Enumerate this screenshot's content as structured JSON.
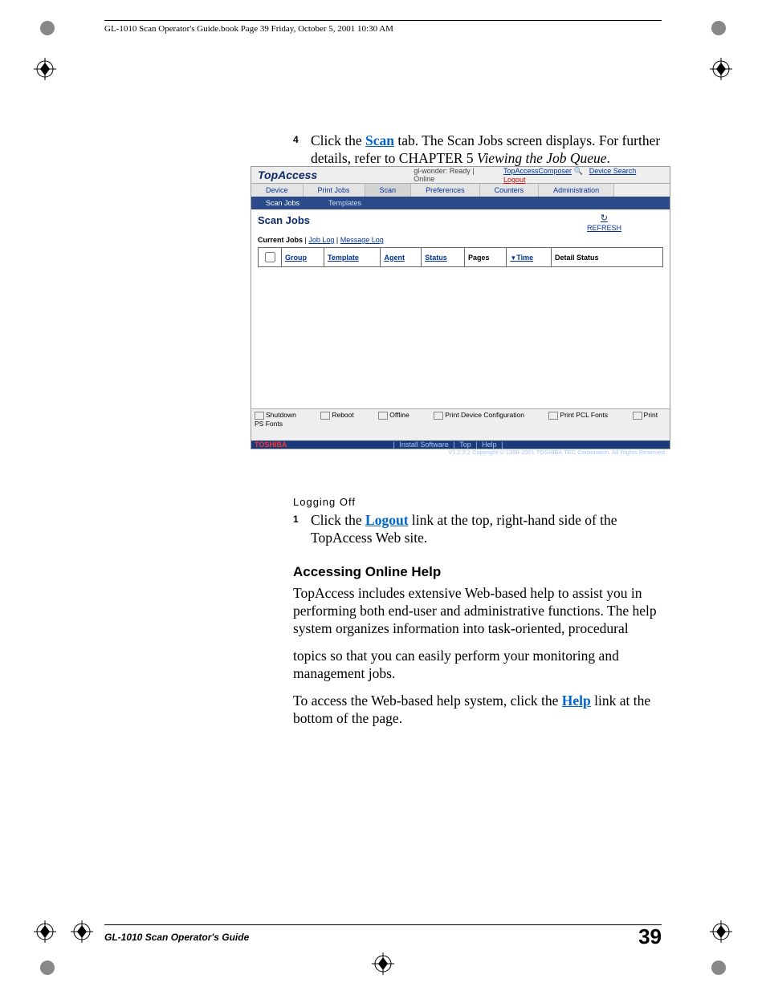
{
  "header_text": "GL-1010 Scan Operator's Guide.book  Page 39  Friday, October 5, 2001  10:30 AM",
  "step4": {
    "num": "4",
    "pre": "Click the ",
    "link": "Scan",
    "post1": " tab. The Scan Jobs screen displays. For further details, refer to CHAPTER 5 ",
    "italic": "Viewing the Job Queue",
    "post2": "."
  },
  "fig": {
    "brand": "TopAccess",
    "status": "gl-wonder: Ready | Online",
    "top_links": {
      "composer": "TopAccessComposer",
      "search": "Device Search",
      "logout": "Logout"
    },
    "tabs": [
      "Device",
      "Print Jobs",
      "Scan",
      "Preferences",
      "Counters",
      "Administration"
    ],
    "subtabs": [
      "Scan Jobs",
      "Templates"
    ],
    "panel_title": "Scan Jobs",
    "refresh": "REFRESH",
    "crumbs": {
      "current": "Current Jobs",
      "joblog": "Job Log",
      "msglog": "Message Log"
    },
    "cols": {
      "group": "Group",
      "template": "Template",
      "agent": "Agent",
      "status": "Status",
      "pages": "Pages",
      "time": "Time",
      "detail": "Detail Status"
    },
    "footer": {
      "shutdown": "Shutdown",
      "reboot": "Reboot",
      "offline": "Offline",
      "pdc": "Print Device Configuration",
      "pcl": "Print PCL Fonts",
      "ps": "Print PS Fonts"
    },
    "bar": {
      "brand": "TOSHIBA",
      "install": "Install Software",
      "top": "Top",
      "help": "Help",
      "copy": "V1.2.3.2  Copyright © 1999-2001 TOSHIBA TEC Corporation, All Rights Reserved."
    }
  },
  "logging_off_h": "Logging Off",
  "step1": {
    "num": "1",
    "pre": "Click the ",
    "link": "Logout",
    "post": " link at the top, right-hand side of the TopAccess Web site."
  },
  "help_h": "Accessing Online Help",
  "help_p1": "TopAccess includes extensive Web-based help to assist you in performing both end-user and administrative functions. The help system organizes information into task-oriented, procedural",
  "help_p2": "topics so that you can easily perform your monitoring and management jobs.",
  "help_p3_pre": "To access the Web-based help system, click the ",
  "help_link": "Help",
  "help_p3_post": " link at the bottom of the page.",
  "footer_text": "GL-1010 Scan Operator's Guide",
  "page_num": "39"
}
